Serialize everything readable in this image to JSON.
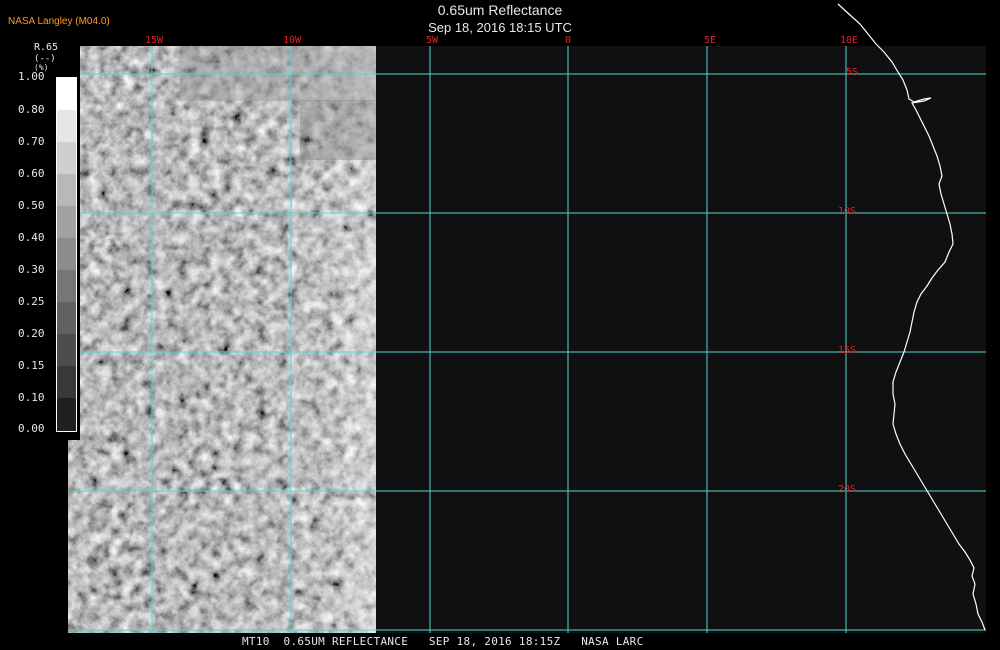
{
  "header": {
    "agency": "NASA Langley (M04.0)",
    "title": "0.65um Reflectance",
    "datetime": "Sep 18, 2016 18:15 UTC"
  },
  "longitude_labels": [
    "15W",
    "10W",
    "5W",
    "0",
    "5E",
    "10E"
  ],
  "latitude_labels": [
    "5S",
    "10S",
    "15S",
    "20S"
  ],
  "legend": {
    "title": "R.65",
    "units": "(--)",
    "percent_hint": "(%)",
    "ticks": [
      "1.00",
      "0.80",
      "0.70",
      "0.60",
      "0.50",
      "0.40",
      "0.30",
      "0.25",
      "0.20",
      "0.15",
      "0.10",
      "0.00"
    ]
  },
  "footer": {
    "text": "MT10  0.65UM REFLECTANCE   SEP 18, 2016 18:15Z   NASA LARC"
  },
  "colors": {
    "grid": "#4fd6d6",
    "labels": "#e0222a",
    "agency": "#ff9a1f",
    "background": "#101010",
    "coast": "#ffffff"
  }
}
